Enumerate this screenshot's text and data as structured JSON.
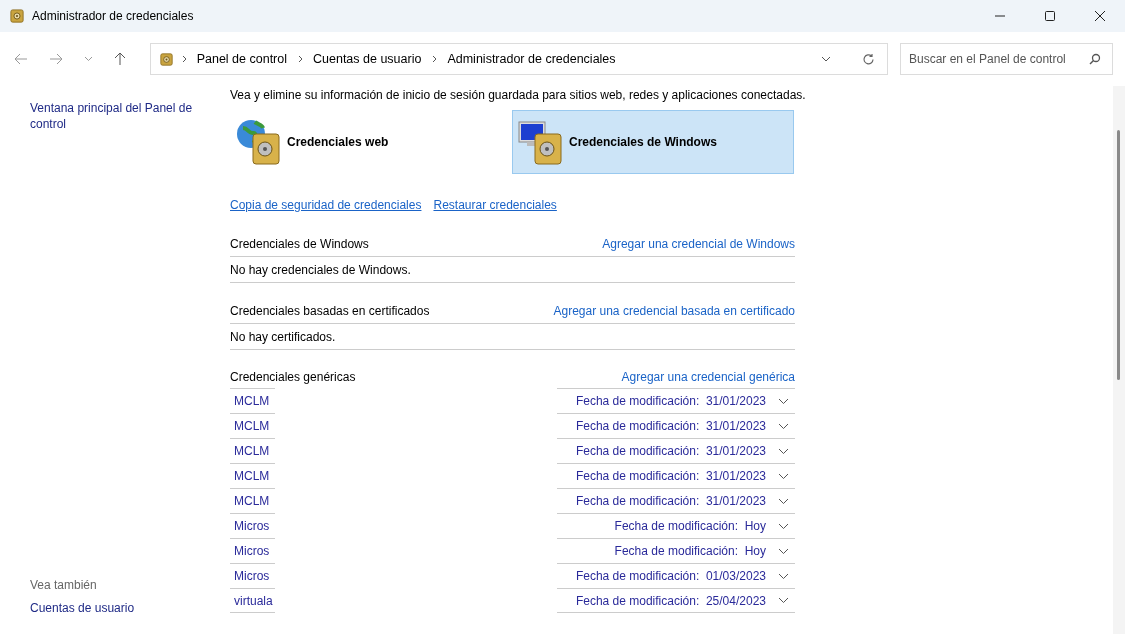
{
  "window": {
    "title": "Administrador de credenciales"
  },
  "navigation": {
    "breadcrumb": [
      "Panel de control",
      "Cuentas de usuario",
      "Administrador de credenciales"
    ],
    "search": {
      "placeholder": "Buscar en el Panel de control"
    }
  },
  "sidebar": {
    "links": [
      "Ventana principal del Panel de control"
    ],
    "see_also": {
      "heading": "Vea también",
      "links": [
        "Cuentas de usuario"
      ]
    }
  },
  "main": {
    "description": "Vea y elimine su información de inicio de sesión guardada para sitios web, redes y aplicaciones conectadas.",
    "credential_types": [
      {
        "label": "Credenciales web",
        "kind": "web",
        "selected": false
      },
      {
        "label": "Credenciales de Windows",
        "kind": "windows",
        "selected": true
      }
    ],
    "links": [
      "Copia de seguridad de credenciales",
      "Restaurar credenciales"
    ],
    "sections": [
      {
        "title": "Credenciales de Windows",
        "add_link": "Agregar una credencial de Windows",
        "empty_text": "No hay credenciales de Windows."
      },
      {
        "title": "Credenciales basadas en certificados",
        "add_link": "Agregar una credencial basada en certificado",
        "empty_text": "No hay certificados."
      },
      {
        "title": "Credenciales genéricas",
        "add_link": "Agregar una credencial genérica",
        "items": [
          {
            "name": "MCLM",
            "modified_label": "Fecha de modificación:",
            "date": "31/01/2023",
            "expanded": false
          },
          {
            "name": "MCLM",
            "modified_label": "Fecha de modificación:",
            "date": "31/01/2023",
            "expanded": false
          },
          {
            "name": "MCLM",
            "modified_label": "Fecha de modificación:",
            "date": "31/01/2023",
            "expanded": false
          },
          {
            "name": "MCLM",
            "modified_label": "Fecha de modificación:",
            "date": "31/01/2023",
            "expanded": false
          },
          {
            "name": "MCLM",
            "modified_label": "Fecha de modificación:",
            "date": "31/01/2023",
            "expanded": false
          },
          {
            "name": "Micros",
            "modified_label": "Fecha de modificación:",
            "date": "Hoy",
            "expanded": false
          },
          {
            "name": "Micros",
            "modified_label": "Fecha de modificación:",
            "date": "Hoy",
            "expanded": false
          },
          {
            "name": "Micros",
            "modified_label": "Fecha de modificación:",
            "date": "01/03/2023",
            "expanded": false
          },
          {
            "name": "virtuala",
            "modified_label": "Fecha de modificación:",
            "date": "25/04/2023",
            "expanded": false
          }
        ]
      }
    ]
  }
}
